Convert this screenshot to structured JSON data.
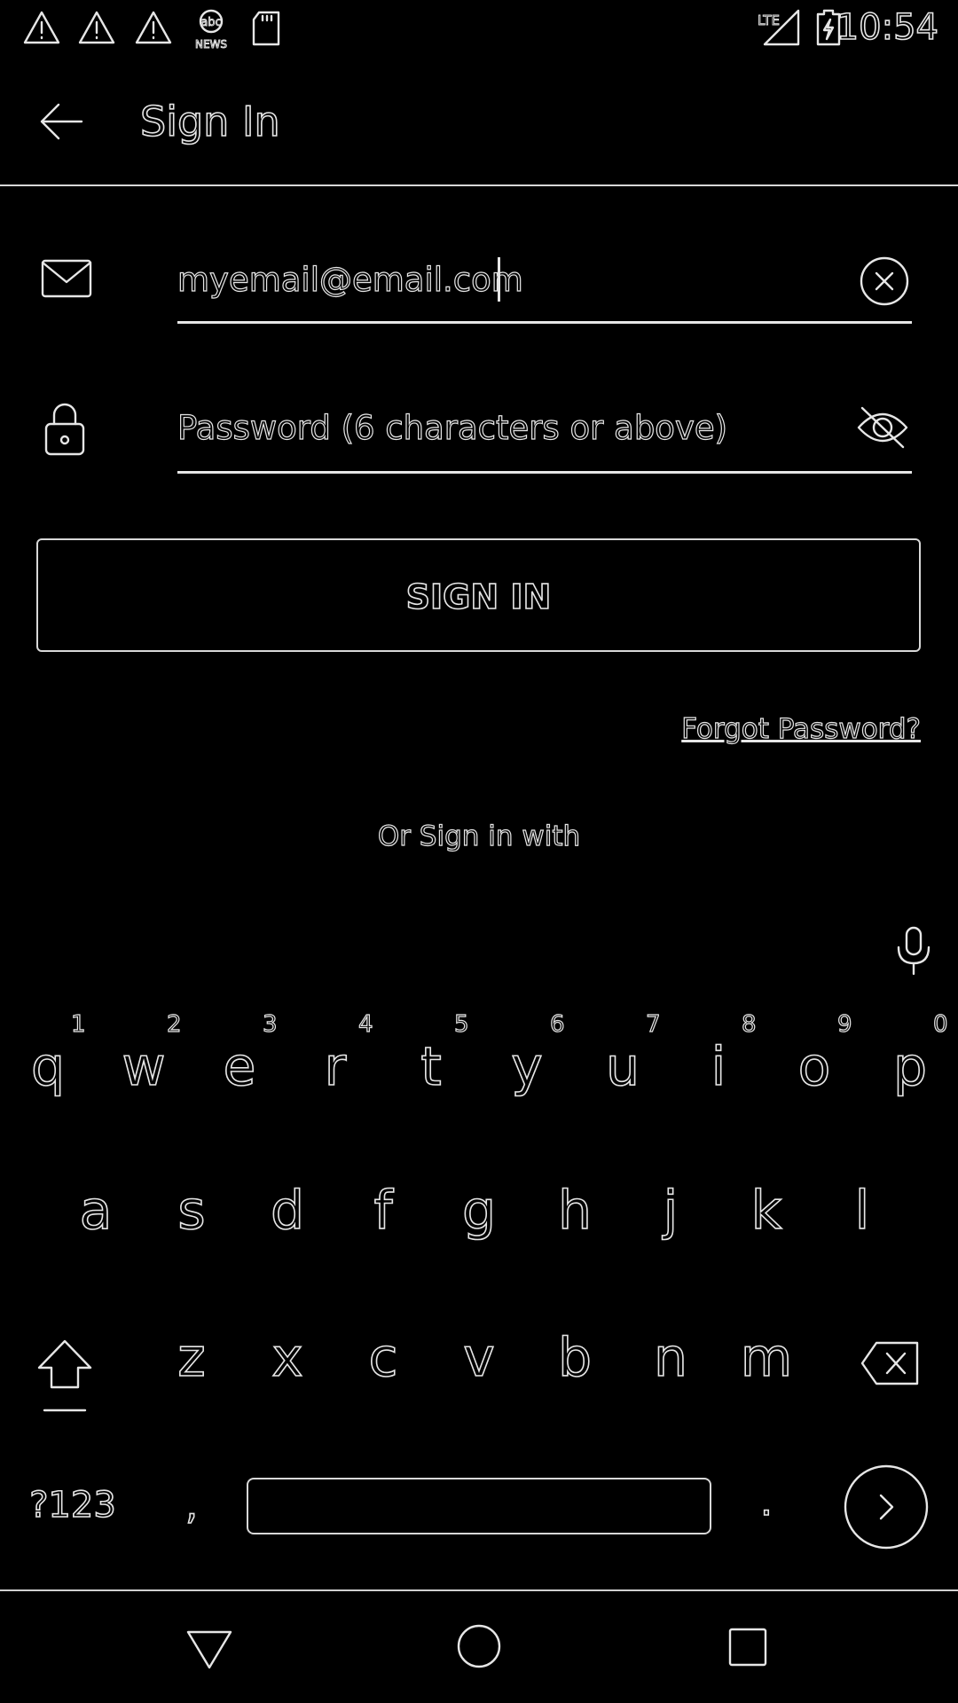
{
  "status_bar": {
    "time": "10:54",
    "left_icons": [
      "warning-icon",
      "warning-icon",
      "warning-icon",
      "abc-news-icon",
      "sd-card-icon"
    ],
    "right_icons": [
      "lte-signal-icon",
      "battery-charging-icon"
    ]
  },
  "app_bar": {
    "title": "Sign In",
    "back_icon": "arrow-left-icon"
  },
  "email_field": {
    "value": "myemail@email.com",
    "icon": "mail-icon",
    "clear_icon": "clear-circle-icon"
  },
  "password_field": {
    "placeholder": "Password (6 characters or above)",
    "icon": "lock-icon",
    "visibility_icon": "eye-off-icon"
  },
  "sign_in_button": {
    "label": "SIGN IN"
  },
  "forgot_password": {
    "label": "Forgot Password?"
  },
  "or_sign_in_with": {
    "label": "Or Sign in with"
  },
  "keyboard": {
    "mic_icon": "microphone-icon",
    "row1": [
      {
        "key": "q",
        "hint": "1"
      },
      {
        "key": "w",
        "hint": "2"
      },
      {
        "key": "e",
        "hint": "3"
      },
      {
        "key": "r",
        "hint": "4"
      },
      {
        "key": "t",
        "hint": "5"
      },
      {
        "key": "y",
        "hint": "6"
      },
      {
        "key": "u",
        "hint": "7"
      },
      {
        "key": "i",
        "hint": "8"
      },
      {
        "key": "o",
        "hint": "9"
      },
      {
        "key": "p",
        "hint": "0"
      }
    ],
    "row2": [
      "a",
      "s",
      "d",
      "f",
      "g",
      "h",
      "j",
      "k",
      "l"
    ],
    "row3": [
      "z",
      "x",
      "c",
      "v",
      "b",
      "n",
      "m"
    ],
    "shift_icon": "shift-icon",
    "backspace_icon": "backspace-icon",
    "symbols_label": "?123",
    "comma": ",",
    "period": ".",
    "enter_icon": "go-arrow-icon"
  },
  "nav_bar": {
    "back_icon": "triangle-back-icon",
    "home_icon": "circle-home-icon",
    "recents_icon": "square-recents-icon"
  }
}
